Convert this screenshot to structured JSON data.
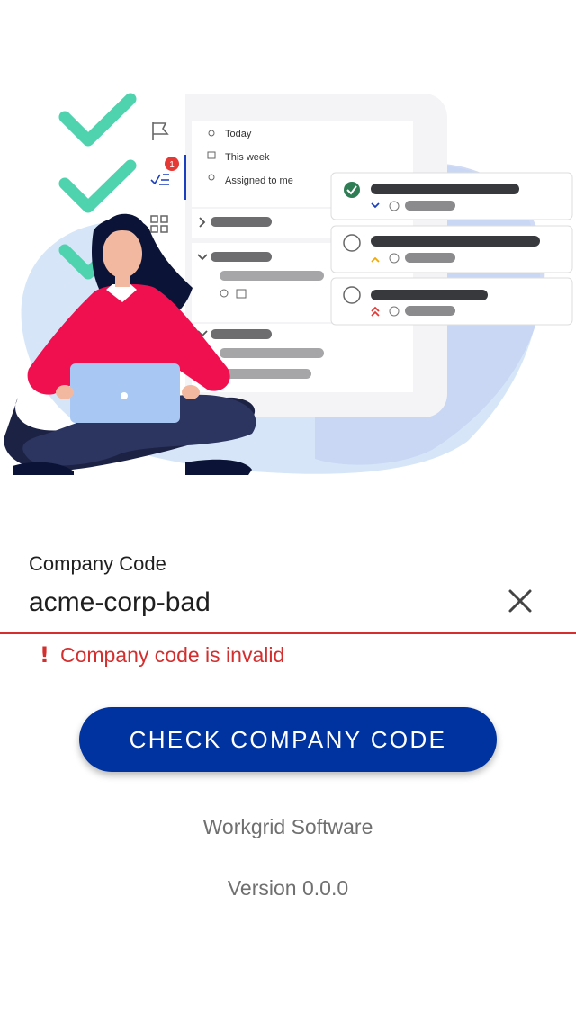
{
  "illustration": {
    "menu_items": [
      "Today",
      "This week",
      "Assigned to me"
    ],
    "badge_count": "1"
  },
  "form": {
    "label": "Company Code",
    "value": "acme-corp-bad",
    "error_message": "Company code is invalid",
    "error_icon_glyph": "!"
  },
  "actions": {
    "submit_label": "CHECK COMPANY CODE"
  },
  "footer": {
    "company": "Workgrid Software",
    "version": "Version 0.0.0"
  },
  "colors": {
    "brand_primary": "#0033a0",
    "error": "#d32f2f",
    "check_green": "#4fd3ae",
    "shirt": "#f0104f"
  },
  "icons": [
    "check-icon",
    "flag-icon",
    "tasks-icon",
    "apps-grid-icon",
    "chat-icon",
    "close-icon",
    "error-icon"
  ]
}
